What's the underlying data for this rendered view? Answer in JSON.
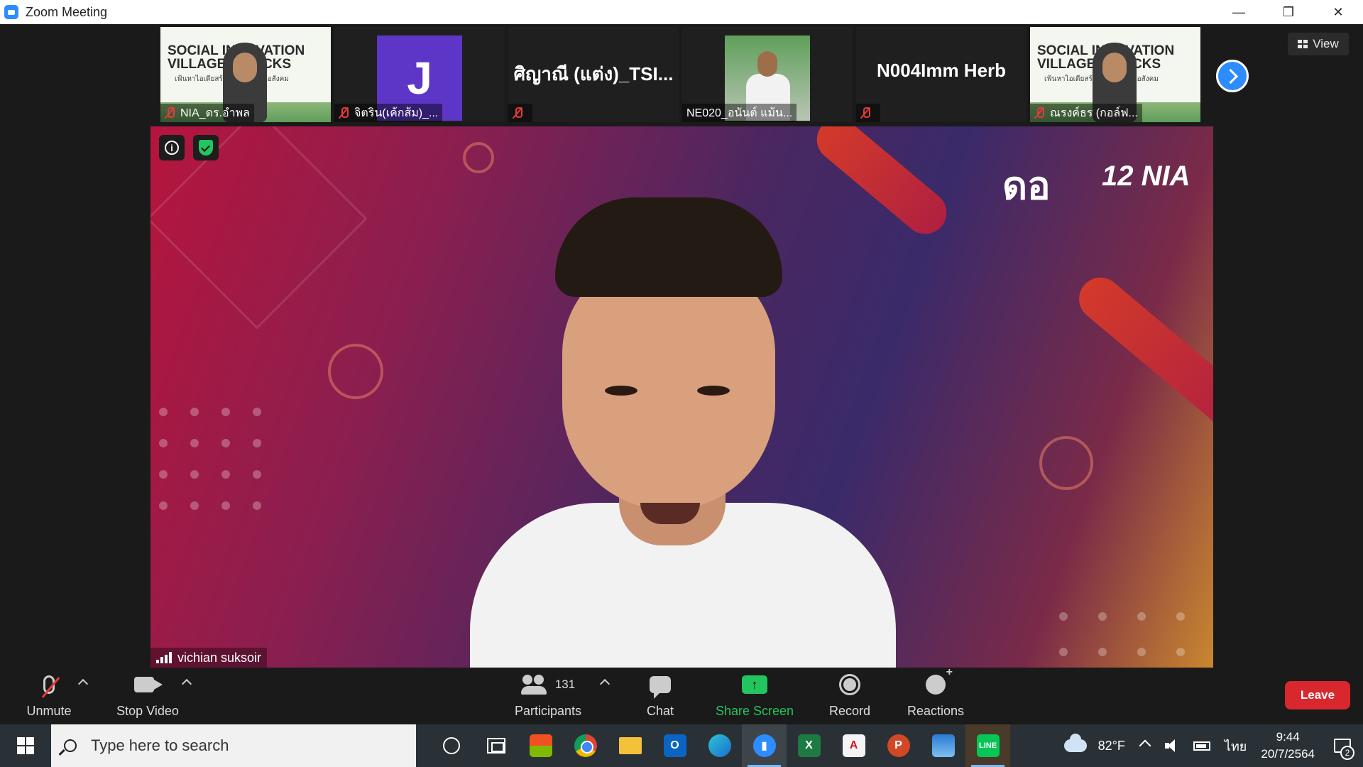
{
  "window": {
    "title": "Zoom Meeting"
  },
  "thumbnails": [
    {
      "name": "NIA_ดร.อำพล",
      "type": "poster",
      "poster_line1": "SOCIAL INNOVATION",
      "poster_line2": "VILLAGE & HACKS",
      "poster_sub": "เฟ้นหาไอเดียสร้างนวัตกรรมเพื่อสังคม"
    },
    {
      "name": "จิตริน(เค้กส้ม)_...",
      "type": "avatar",
      "initial": "J"
    },
    {
      "name": "",
      "type": "name-only",
      "display_name": "ศิญาณี (แต่ง)_TSI..."
    },
    {
      "name": "NE020_อนันต์ แม้น...",
      "type": "photo"
    },
    {
      "name": "",
      "type": "name-only",
      "display_name": "N004Imm Herb"
    },
    {
      "name": "ณรงค์ธร (กอล์ฟ...",
      "type": "poster",
      "poster_line1": "SOCIAL INNOVATION",
      "poster_line2": "VILLAGE & HACKS",
      "poster_sub": "เฟ้นหาไอเดียสร้างนวัตกรรมเพื่อสังคม"
    }
  ],
  "view_button": {
    "label": "View",
    "icon": "grid-icon"
  },
  "speaker": {
    "name": "vichian suksoir",
    "logo_left": "ดอ",
    "logo_right": "12 NIA"
  },
  "toolbar": {
    "unmute": "Unmute",
    "stop_video": "Stop Video",
    "participants": "Participants",
    "participants_count": "131",
    "chat": "Chat",
    "share_screen": "Share Screen",
    "record": "Record",
    "reactions": "Reactions",
    "leave": "Leave"
  },
  "colors": {
    "share_green": "#22c55e",
    "leave_red": "#d9272e",
    "zoom_blue": "#2d8cff"
  },
  "taskbar": {
    "search_placeholder": "Type here to search",
    "weather": "82°F",
    "language": "ไทย",
    "time": "9:44",
    "date": "20/7/2564",
    "notification_count": "2"
  }
}
